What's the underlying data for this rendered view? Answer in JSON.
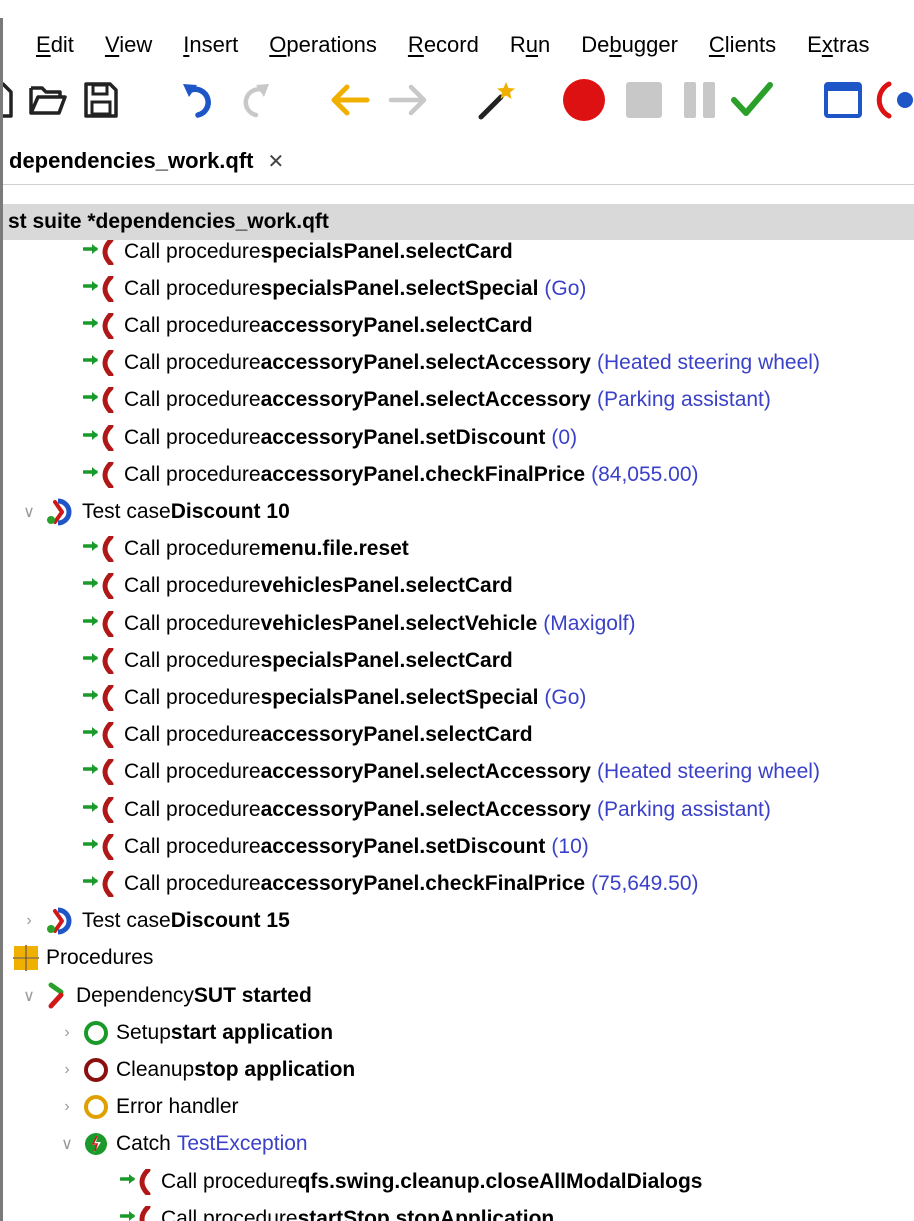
{
  "menu": {
    "items": [
      {
        "pre": "",
        "acc": "E",
        "post": "dit"
      },
      {
        "pre": "",
        "acc": "V",
        "post": "iew"
      },
      {
        "pre": "",
        "acc": "I",
        "post": "nsert"
      },
      {
        "pre": "",
        "acc": "O",
        "post": "perations"
      },
      {
        "pre": "",
        "acc": "R",
        "post": "ecord"
      },
      {
        "pre": "R",
        "acc": "u",
        "post": "n"
      },
      {
        "pre": "De",
        "acc": "b",
        "post": "ugger"
      },
      {
        "pre": "",
        "acc": "C",
        "post": "lients"
      },
      {
        "pre": "E",
        "acc": "x",
        "post": "tras"
      }
    ]
  },
  "toolbar": {
    "buttons": [
      "new-icon",
      "open-folder-icon",
      "save-icon",
      "undo-icon",
      "redo-icon",
      "back-icon",
      "forward-icon",
      "wand-icon",
      "record-icon",
      "stop-icon",
      "pause-icon",
      "check-icon",
      "window-icon",
      "capture-icon"
    ]
  },
  "tabs": {
    "active_label": "dependencies_work.qft",
    "close_glyph": "✕"
  },
  "suite": {
    "header": "st suite *dependencies_work.qft"
  },
  "tree": {
    "rows": [
      {
        "indent": 2,
        "kind": "call",
        "prefix": "Call procedure",
        "name": "specialsPanel.selectCard",
        "param": ""
      },
      {
        "indent": 2,
        "kind": "call",
        "prefix": "Call procedure",
        "name": "specialsPanel.selectSpecial",
        "param": "(Go)"
      },
      {
        "indent": 2,
        "kind": "call",
        "prefix": "Call procedure",
        "name": "accessoryPanel.selectCard",
        "param": ""
      },
      {
        "indent": 2,
        "kind": "call",
        "prefix": "Call procedure",
        "name": "accessoryPanel.selectAccessory",
        "param": "(Heated steering wheel)"
      },
      {
        "indent": 2,
        "kind": "call",
        "prefix": "Call procedure",
        "name": "accessoryPanel.selectAccessory",
        "param": "(Parking assistant)"
      },
      {
        "indent": 2,
        "kind": "call",
        "prefix": "Call procedure",
        "name": "accessoryPanel.setDiscount",
        "param": "(0)"
      },
      {
        "indent": 2,
        "kind": "call",
        "prefix": "Call procedure",
        "name": "accessoryPanel.checkFinalPrice",
        "param": "(84,055.00)"
      },
      {
        "indent": 1,
        "kind": "testcase",
        "twisty": "expanded",
        "prefix": "Test case",
        "name": "Discount 10",
        "param": ""
      },
      {
        "indent": 2,
        "kind": "call",
        "prefix": "Call procedure",
        "name": "menu.file.reset",
        "param": ""
      },
      {
        "indent": 2,
        "kind": "call",
        "prefix": "Call procedure",
        "name": "vehiclesPanel.selectCard",
        "param": ""
      },
      {
        "indent": 2,
        "kind": "call",
        "prefix": "Call procedure",
        "name": "vehiclesPanel.selectVehicle",
        "param": "(Maxigolf)"
      },
      {
        "indent": 2,
        "kind": "call",
        "prefix": "Call procedure",
        "name": "specialsPanel.selectCard",
        "param": ""
      },
      {
        "indent": 2,
        "kind": "call",
        "prefix": "Call procedure",
        "name": "specialsPanel.selectSpecial",
        "param": "(Go)"
      },
      {
        "indent": 2,
        "kind": "call",
        "prefix": "Call procedure",
        "name": "accessoryPanel.selectCard",
        "param": ""
      },
      {
        "indent": 2,
        "kind": "call",
        "prefix": "Call procedure",
        "name": "accessoryPanel.selectAccessory",
        "param": "(Heated steering wheel)"
      },
      {
        "indent": 2,
        "kind": "call",
        "prefix": "Call procedure",
        "name": "accessoryPanel.selectAccessory",
        "param": "(Parking assistant)"
      },
      {
        "indent": 2,
        "kind": "call",
        "prefix": "Call procedure",
        "name": "accessoryPanel.setDiscount",
        "param": "(10)"
      },
      {
        "indent": 2,
        "kind": "call",
        "prefix": "Call procedure",
        "name": "accessoryPanel.checkFinalPrice",
        "param": "(75,649.50)"
      },
      {
        "indent": 1,
        "kind": "testcase",
        "twisty": "collapsed",
        "prefix": "Test case",
        "name": "Discount 15",
        "param": ""
      },
      {
        "indent": 0,
        "kind": "procedures",
        "prefix": "Procedures",
        "name": "",
        "param": ""
      },
      {
        "indent": 1,
        "kind": "dependency",
        "twisty": "expanded",
        "prefix": "Dependency",
        "name": "SUT started",
        "param": ""
      },
      {
        "indent": 2,
        "kind": "setup",
        "twisty": "collapsed",
        "prefix": "Setup",
        "name": "start application",
        "param": ""
      },
      {
        "indent": 2,
        "kind": "cleanup",
        "twisty": "collapsed",
        "prefix": "Cleanup",
        "name": "stop application",
        "param": ""
      },
      {
        "indent": 2,
        "kind": "errorhandler",
        "twisty": "collapsed",
        "prefix": "Error handler",
        "name": "",
        "param": ""
      },
      {
        "indent": 2,
        "kind": "catch",
        "twisty": "expanded",
        "prefix": "Catch",
        "name": "",
        "param": "TestException"
      },
      {
        "indent": 3,
        "kind": "call",
        "prefix": "Call procedure",
        "name": "qfs.swing.cleanup.closeAllModalDialogs",
        "param": ""
      },
      {
        "indent": 3,
        "kind": "call",
        "prefix": "Call procedure",
        "name": "startStop.stopApplication",
        "param": ""
      }
    ]
  },
  "colors": {
    "param_text": "#3a41c8",
    "header_bg": "#d9d9d9",
    "call_arrow": "#1a9a2a",
    "call_paren": "#b01818",
    "record": "#dd1111",
    "check": "#2aa02a",
    "undo": "#1e56c8",
    "nav_arrow": "#f0b000"
  }
}
